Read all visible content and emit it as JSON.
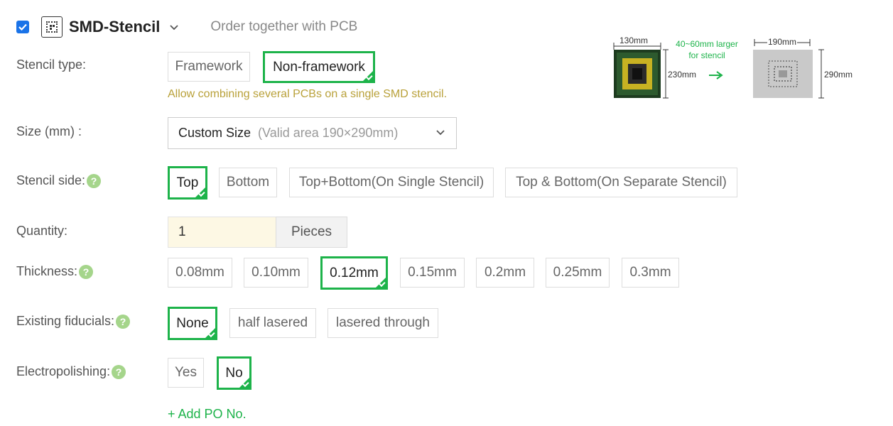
{
  "header": {
    "checked": true,
    "title": "SMD-Stencil",
    "subtitle": "Order together with PCB"
  },
  "stencil_type": {
    "label": "Stencil type:",
    "options": [
      "Framework",
      "Non-framework"
    ],
    "selected": "Non-framework",
    "hint": "Allow combining several PCBs on a single SMD stencil."
  },
  "size": {
    "label": "Size (mm) :",
    "value": "Custom Size",
    "note": "(Valid area 190×290mm)"
  },
  "stencil_side": {
    "label": "Stencil side:",
    "options": [
      "Top",
      "Bottom",
      "Top+Bottom(On Single Stencil)",
      "Top & Bottom(On Separate Stencil)"
    ],
    "selected": "Top"
  },
  "quantity": {
    "label": "Quantity:",
    "value": "1",
    "unit": "Pieces"
  },
  "thickness": {
    "label": "Thickness:",
    "options": [
      "0.08mm",
      "0.10mm",
      "0.12mm",
      "0.15mm",
      "0.2mm",
      "0.25mm",
      "0.3mm"
    ],
    "selected": "0.12mm"
  },
  "fiducials": {
    "label": "Existing fiducials:",
    "options": [
      "None",
      "half lasered",
      "lasered through"
    ],
    "selected": "None"
  },
  "electropolishing": {
    "label": "Electropolishing:",
    "options": [
      "Yes",
      "No"
    ],
    "selected": "No"
  },
  "add_po": "+ Add PO No.",
  "diagram": {
    "pcb_width": "130mm",
    "pcb_height": "230mm",
    "note_line1": "40~60mm larger",
    "note_line2": "for stencil",
    "stencil_width": "190mm",
    "stencil_height": "290mm"
  },
  "help_icon": "?",
  "colors": {
    "selected_border": "#1db34a",
    "hint_text": "#b9a13a",
    "help_icon": "#a5d58b",
    "checkbox": "#1a73e8",
    "quantity_bg": "#fdf8e4"
  }
}
